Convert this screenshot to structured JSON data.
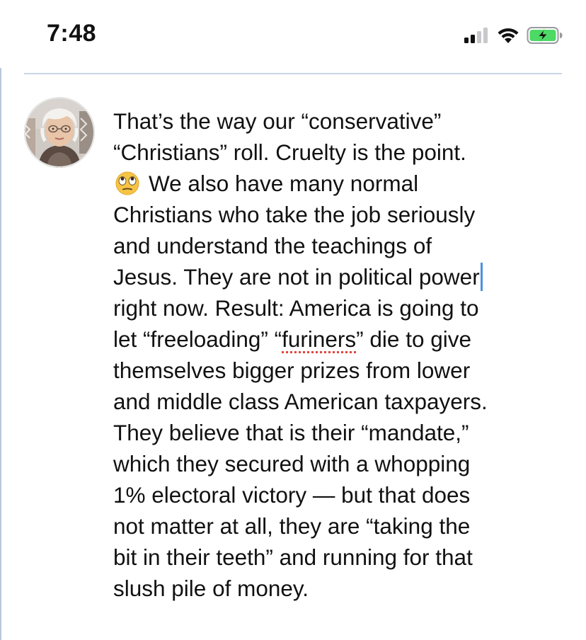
{
  "status_bar": {
    "time": "7:48",
    "icons": [
      "cellular-signal-icon",
      "wifi-icon",
      "battery-charging-icon"
    ],
    "battery_color": "#4cd964"
  },
  "post": {
    "avatar": "user-avatar",
    "message_lines": {
      "l1": "That’s the way our “conservative”",
      "l2": "“Christians” roll. Cruelty is the point.",
      "l3": "We also have many normal",
      "l4": "Christians who take the job seriously",
      "l5": "and understand the teachings of",
      "l6": "Jesus. They are not in political power",
      "l7a": "right now. Result: America is going to",
      "l8a": "let “freeloading” “",
      "l8b": "furiners",
      "l8c": "” die to give",
      "l9": "themselves bigger prizes from lower",
      "l10": "and middle class American taxpayers.",
      "l11": "They believe that is their “mandate,”",
      "l12": "which they secured with a whopping",
      "l13": "1% electoral victory — but that does",
      "l14": "not matter at all, they are “taking the",
      "l15": "bit in their teeth” and running for that",
      "l16": "slush pile of money."
    },
    "emoji": "face-with-rolling-eyes-icon",
    "accent_color": "#4a90e2",
    "spellcheck_color": "#e0453a"
  }
}
